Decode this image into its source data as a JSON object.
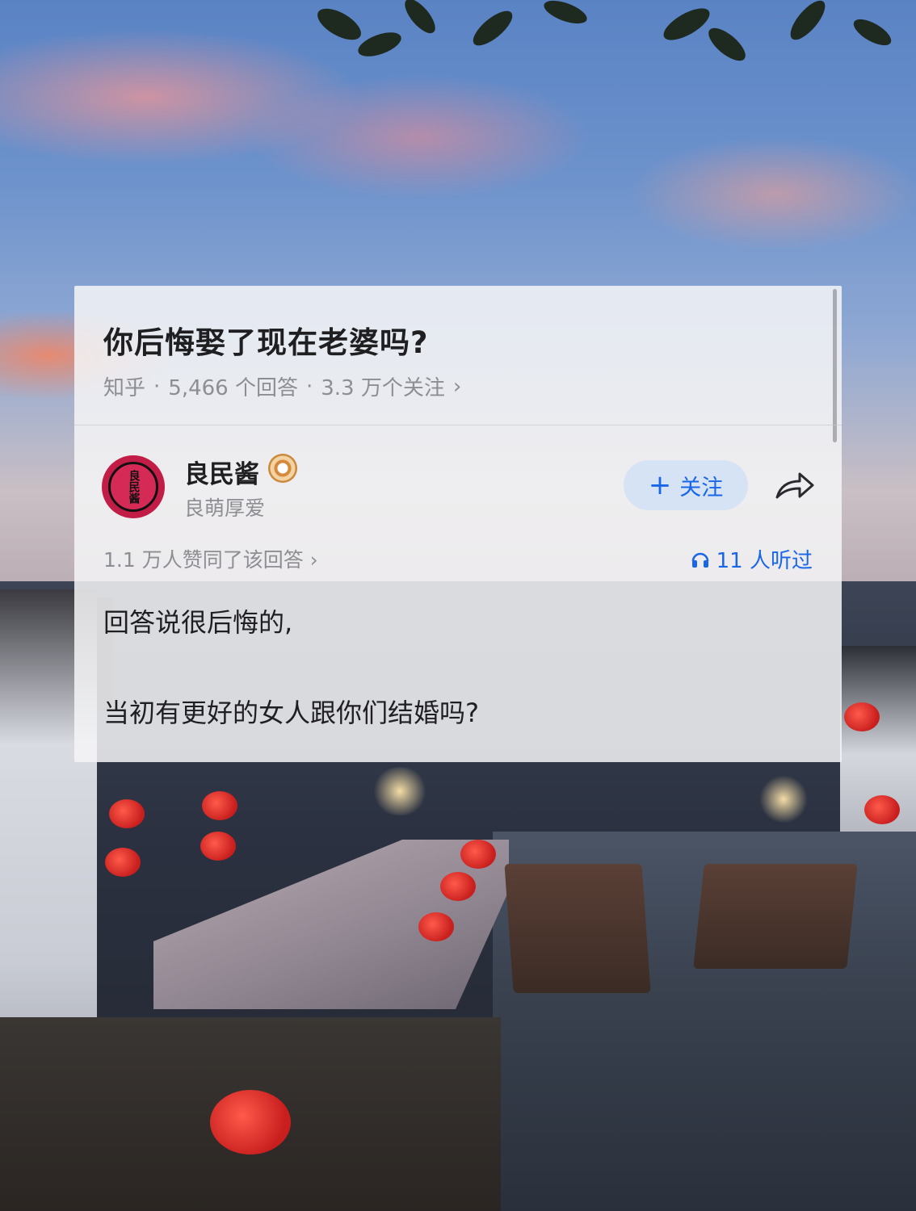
{
  "question": {
    "title": "你后悔娶了现在老婆吗?",
    "source": "知乎",
    "answers_count": "5,466 个回答",
    "followers_count": "3.3 万个关注",
    "separator": "·",
    "chevron": "›"
  },
  "author": {
    "name": "良民酱",
    "subtitle": "良萌厚爱",
    "avatar_text": "良民酱",
    "badge_icon": "verified-eye-icon"
  },
  "actions": {
    "follow_label": "关注",
    "follow_plus": "+",
    "share_icon": "share-arrow-icon"
  },
  "stats": {
    "votes": "1.1 万人赞同了该回答 ›",
    "listens": "11 人听过",
    "listen_icon": "headphones-icon"
  },
  "answer": {
    "lines": [
      "回答说很后悔的,",
      "当初有更好的女人跟你们结婚吗?"
    ]
  },
  "colors": {
    "accent": "#1a66e8",
    "muted": "#8d8e93",
    "text": "#1f1f22",
    "avatar": "#c21d47"
  }
}
